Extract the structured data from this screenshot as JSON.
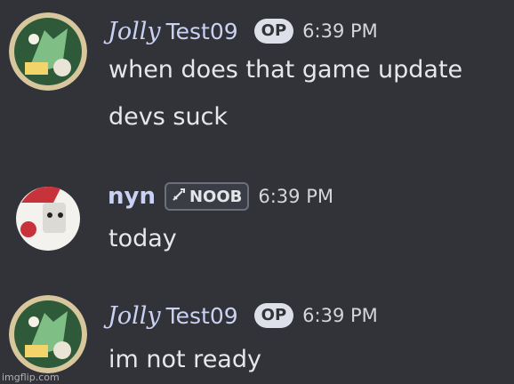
{
  "messages": [
    {
      "author_script": "Jolly",
      "author_plain": "Test09",
      "badge": "OP",
      "time": "6:39 PM",
      "lines": [
        "when does that game update",
        "devs suck"
      ]
    },
    {
      "author": "nyn",
      "tag_icon": "sword-icon",
      "tag": "NOOB",
      "time": "6:39 PM",
      "lines": [
        "today"
      ]
    },
    {
      "author_script": "Jolly",
      "author_plain": "Test09",
      "badge": "OP",
      "time": "6:39 PM",
      "lines": [
        "im not ready"
      ]
    }
  ],
  "watermark": "imgflip.com",
  "colors": {
    "background": "#313338",
    "username": "#cbd1f3",
    "badge": "#dde0e8"
  }
}
